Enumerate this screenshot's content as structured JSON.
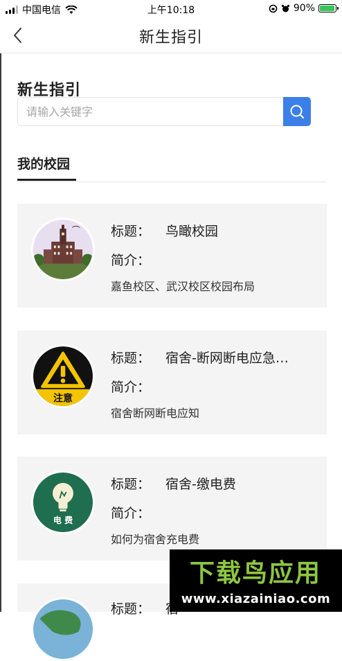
{
  "status": {
    "carrier": "中国电信",
    "time": "上午10:18",
    "battery": "90%",
    "battery_level": 0.9
  },
  "nav": {
    "title": "新生指引",
    "back_icon": "chevron-left-icon"
  },
  "page": {
    "section_title": "新生指引",
    "search": {
      "placeholder": "请输入关键字",
      "button_icon": "search-icon"
    },
    "tabs": [
      {
        "label": "我的校园",
        "active": true
      }
    ]
  },
  "colors": {
    "accent_blue": "#3d7fe8",
    "card_bg": "#f4f4f4",
    "warning_yellow": "#f5c400",
    "electric_green": "#1f6e4f"
  },
  "cards": [
    {
      "title_label": "标题：",
      "title": "鸟瞰校园",
      "intro_label": "简介：",
      "desc": "嘉鱼校区、武汉校区校园布局",
      "icon": "campus-building-icon"
    },
    {
      "title_label": "标题：",
      "title": "宿舍-断网断电应急…",
      "intro_label": "简介：",
      "desc": "宿舍断网断电应知",
      "icon": "warning-icon",
      "icon_text": "注意"
    },
    {
      "title_label": "标题：",
      "title": "宿舍-缴电费",
      "intro_label": "简介：",
      "desc": "如何为宿舍充电费",
      "icon": "lightbulb-icon",
      "icon_text": "电 费"
    },
    {
      "title_label": "标题：",
      "title": "宿",
      "icon": "globe-icon"
    }
  ],
  "watermark": {
    "logo_text": "下载鸟应用",
    "url": "www.xiazainiao.com"
  }
}
